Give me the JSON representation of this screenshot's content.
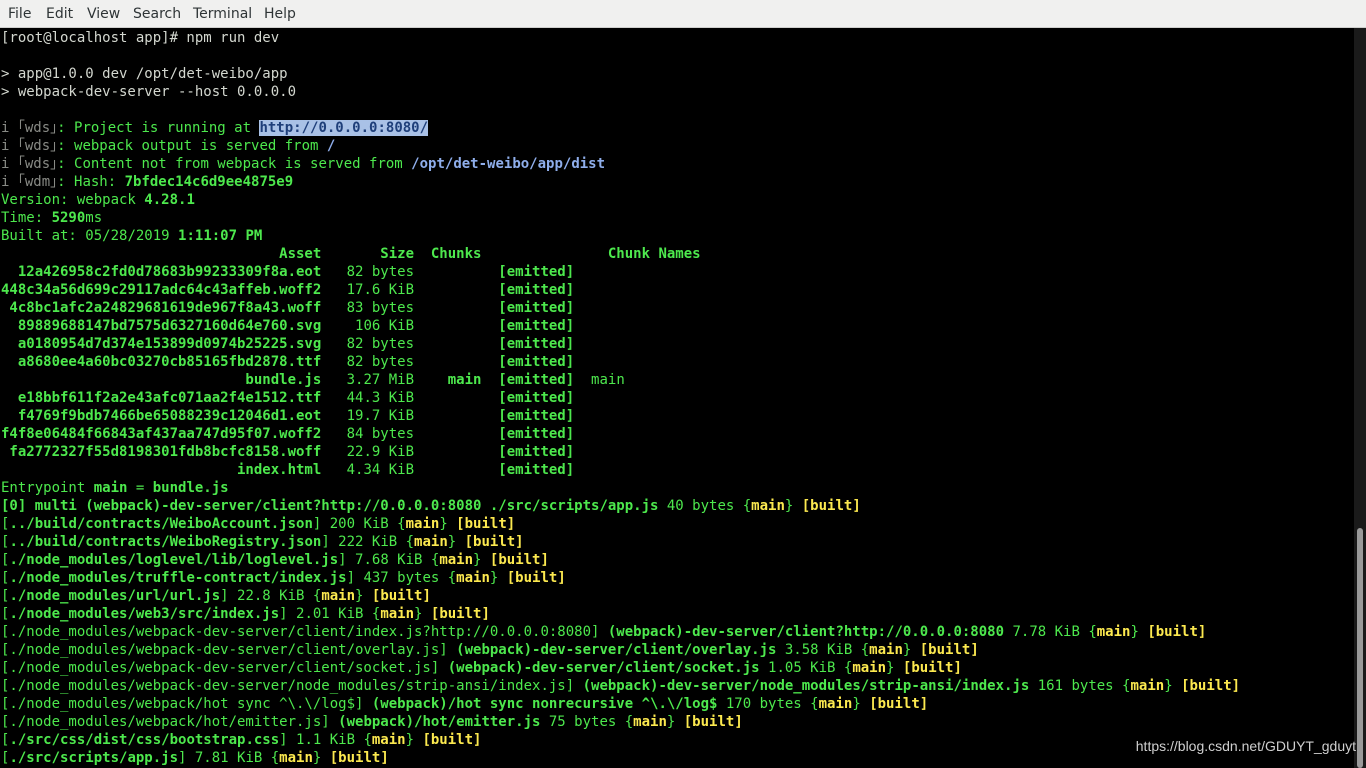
{
  "menu": [
    "File",
    "Edit",
    "View",
    "Search",
    "Terminal",
    "Help"
  ],
  "prompt": "[root@localhost app]# npm run dev",
  "npm": [
    "> app@1.0.0 dev /opt/det-weibo/app",
    "> webpack-dev-server --host 0.0.0.0"
  ],
  "wds": [
    {
      "tag": "wds",
      "text": ": Project is running at ",
      "value": "http://0.0.0.0:8080/"
    },
    {
      "tag": "wds",
      "text": ": webpack output is served from ",
      "value": "/"
    },
    {
      "tag": "wds",
      "text": ": Content not from webpack is served from ",
      "value": "/opt/det-weibo/app/dist"
    },
    {
      "tag": "wdm",
      "text": ": Hash: ",
      "value": "7bfdec14c6d9ee4875e9"
    }
  ],
  "version": {
    "label": "Version: webpack ",
    "value": "4.28.1"
  },
  "time": {
    "label": "Time: ",
    "value": "5290",
    "unit": "ms"
  },
  "built_at": {
    "label": "Built at: ",
    "date": "05/28/2019",
    "time": "1:11:07 PM"
  },
  "asset_table": {
    "headers": [
      "Asset",
      "Size",
      "Chunks",
      "",
      "Chunk Names"
    ],
    "rows": [
      {
        "asset": "12a426958c2fd0d78683b99233309f8a.eot",
        "size": "82 bytes",
        "chunks": "",
        "status": "[emitted]",
        "names": ""
      },
      {
        "asset": "448c34a56d699c29117adc64c43affeb.woff2",
        "size": "17.6 KiB",
        "chunks": "",
        "status": "[emitted]",
        "names": ""
      },
      {
        "asset": "4c8bc1afc2a24829681619de967f8a43.woff",
        "size": "83 bytes",
        "chunks": "",
        "status": "[emitted]",
        "names": ""
      },
      {
        "asset": "89889688147bd7575d6327160d64e760.svg",
        "size": "106 KiB",
        "chunks": "",
        "status": "[emitted]",
        "names": ""
      },
      {
        "asset": "a0180954d7d374e153899d0974b25225.svg",
        "size": "82 bytes",
        "chunks": "",
        "status": "[emitted]",
        "names": ""
      },
      {
        "asset": "a8680ee4a60bc03270cb85165fbd2878.ttf",
        "size": "82 bytes",
        "chunks": "",
        "status": "[emitted]",
        "names": ""
      },
      {
        "asset": "bundle.js",
        "size": "3.27 MiB",
        "chunks": "main",
        "status": "[emitted]",
        "names": "main"
      },
      {
        "asset": "e18bbf611f2a2e43afc071aa2f4e1512.ttf",
        "size": "44.3 KiB",
        "chunks": "",
        "status": "[emitted]",
        "names": ""
      },
      {
        "asset": "f4769f9bdb7466be65088239c12046d1.eot",
        "size": "19.7 KiB",
        "chunks": "",
        "status": "[emitted]",
        "names": ""
      },
      {
        "asset": "f4f8e06484f66843af437aa747d95f07.woff2",
        "size": "84 bytes",
        "chunks": "",
        "status": "[emitted]",
        "names": ""
      },
      {
        "asset": "fa2772327f55d8198301fdb8bcfc8158.woff",
        "size": "22.9 KiB",
        "chunks": "",
        "status": "[emitted]",
        "names": ""
      },
      {
        "asset": "index.html",
        "size": "4.34 KiB",
        "chunks": "",
        "status": "[emitted]",
        "names": ""
      }
    ]
  },
  "entrypoint": {
    "label": "Entrypoint ",
    "name": "main",
    "eq": " = ",
    "file": "bundle.js"
  },
  "modules": [
    [
      [
        "gb",
        "[0] multi (webpack)-dev-server/client?http://0.0.0.0:8080 ./src/scripts/app.js"
      ],
      [
        "g",
        " 40 bytes {"
      ],
      [
        "y",
        "main"
      ],
      [
        "g",
        "} "
      ],
      [
        "yb",
        "[built]"
      ]
    ],
    [
      [
        "g",
        "["
      ],
      [
        "gb",
        "../build/contracts/WeiboAccount.json"
      ],
      [
        "g",
        "] 200 KiB {"
      ],
      [
        "y",
        "main"
      ],
      [
        "g",
        "} "
      ],
      [
        "yb",
        "[built]"
      ]
    ],
    [
      [
        "g",
        "["
      ],
      [
        "gb",
        "../build/contracts/WeiboRegistry.json"
      ],
      [
        "g",
        "] 222 KiB {"
      ],
      [
        "y",
        "main"
      ],
      [
        "g",
        "} "
      ],
      [
        "yb",
        "[built]"
      ]
    ],
    [
      [
        "g",
        "["
      ],
      [
        "gb",
        "./node_modules/loglevel/lib/loglevel.js"
      ],
      [
        "g",
        "] 7.68 KiB {"
      ],
      [
        "y",
        "main"
      ],
      [
        "g",
        "} "
      ],
      [
        "yb",
        "[built]"
      ]
    ],
    [
      [
        "g",
        "["
      ],
      [
        "gb",
        "./node_modules/truffle-contract/index.js"
      ],
      [
        "g",
        "] 437 bytes {"
      ],
      [
        "y",
        "main"
      ],
      [
        "g",
        "} "
      ],
      [
        "yb",
        "[built]"
      ]
    ],
    [
      [
        "g",
        "["
      ],
      [
        "gb",
        "./node_modules/url/url.js"
      ],
      [
        "g",
        "] 22.8 KiB {"
      ],
      [
        "y",
        "main"
      ],
      [
        "g",
        "} "
      ],
      [
        "yb",
        "[built]"
      ]
    ],
    [
      [
        "g",
        "["
      ],
      [
        "gb",
        "./node_modules/web3/src/index.js"
      ],
      [
        "g",
        "] 2.01 KiB {"
      ],
      [
        "y",
        "main"
      ],
      [
        "g",
        "} "
      ],
      [
        "yb",
        "[built]"
      ]
    ],
    [
      [
        "g",
        "[./node_modules/webpack-dev-server/client/index.js?http://0.0.0.0:8080] "
      ],
      [
        "gb",
        "(webpack)-dev-server/client?http://0.0.0.0:8080"
      ],
      [
        "g",
        " 7.78 KiB {"
      ],
      [
        "y",
        "main"
      ],
      [
        "g",
        "} "
      ],
      [
        "yb",
        "[built]"
      ]
    ],
    [
      [
        "g",
        "[./node_modules/webpack-dev-server/client/overlay.js] "
      ],
      [
        "gb",
        "(webpack)-dev-server/client/overlay.js"
      ],
      [
        "g",
        " 3.58 KiB {"
      ],
      [
        "y",
        "main"
      ],
      [
        "g",
        "} "
      ],
      [
        "yb",
        "[built]"
      ]
    ],
    [
      [
        "g",
        "[./node_modules/webpack-dev-server/client/socket.js] "
      ],
      [
        "gb",
        "(webpack)-dev-server/client/socket.js"
      ],
      [
        "g",
        " 1.05 KiB {"
      ],
      [
        "y",
        "main"
      ],
      [
        "g",
        "} "
      ],
      [
        "yb",
        "[built]"
      ]
    ],
    [
      [
        "g",
        "[./node_modules/webpack-dev-server/node_modules/strip-ansi/index.js] "
      ],
      [
        "gb",
        "(webpack)-dev-server/node_modules/strip-ansi/index.js"
      ],
      [
        "g",
        " 161 bytes {"
      ],
      [
        "y",
        "main"
      ],
      [
        "g",
        "} "
      ],
      [
        "yb",
        "[built]"
      ]
    ],
    [
      [
        "g",
        "[./node_modules/webpack/hot sync ^\\.\\/log$] "
      ],
      [
        "gb",
        "(webpack)/hot sync nonrecursive ^\\.\\/log$"
      ],
      [
        "g",
        " 170 bytes {"
      ],
      [
        "y",
        "main"
      ],
      [
        "g",
        "} "
      ],
      [
        "yb",
        "[built]"
      ]
    ],
    [
      [
        "g",
        "[./node_modules/webpack/hot/emitter.js] "
      ],
      [
        "gb",
        "(webpack)/hot/emitter.js"
      ],
      [
        "g",
        " 75 bytes {"
      ],
      [
        "y",
        "main"
      ],
      [
        "g",
        "} "
      ],
      [
        "yb",
        "[built]"
      ]
    ],
    [
      [
        "g",
        "["
      ],
      [
        "gb",
        "./src/css/dist/css/bootstrap.css"
      ],
      [
        "g",
        "] 1.1 KiB {"
      ],
      [
        "y",
        "main"
      ],
      [
        "g",
        "} "
      ],
      [
        "yb",
        "[built]"
      ]
    ],
    [
      [
        "g",
        "["
      ],
      [
        "gb",
        "./src/scripts/app.js"
      ],
      [
        "g",
        "] 7.81 KiB {"
      ],
      [
        "y",
        "main"
      ],
      [
        "g",
        "} "
      ],
      [
        "yb",
        "[built]"
      ]
    ]
  ],
  "watermark": "https://blog.csdn.net/GDUYT_gduyt"
}
